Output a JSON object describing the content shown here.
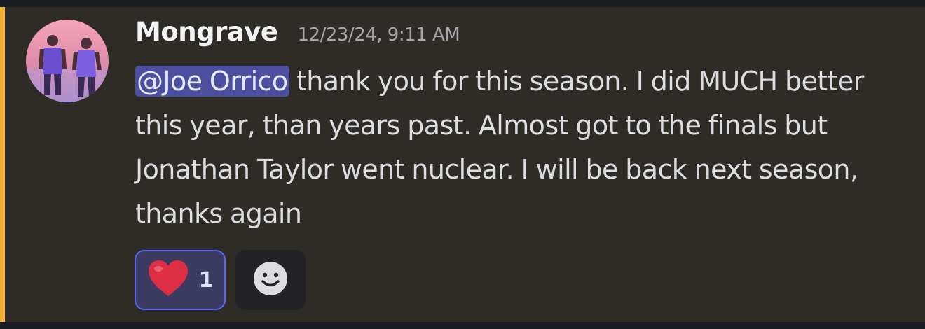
{
  "message": {
    "author": "Mongrave",
    "timestamp": "12/23/24, 9:11 AM",
    "mention": "@Joe Orrico",
    "text": " thank you for this season. I did MUCH better this year, than years past. Almost got to the finals but Jonathan Taylor went nuclear. I will be back next season, thanks again"
  },
  "reactions": [
    {
      "emoji": "heart-icon",
      "count": "1"
    }
  ],
  "add_reaction_icon": "smiley-face-icon",
  "colors": {
    "background": "#2f2c27",
    "highlight_bar": "#f0b232",
    "mention_bg": "#4a4fa0",
    "reaction_border": "#5865f2"
  }
}
